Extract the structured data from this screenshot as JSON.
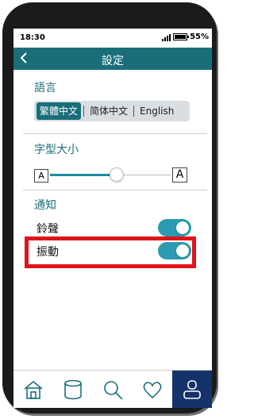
{
  "status_bar": {
    "time": "18:30",
    "battery": "55%"
  },
  "nav": {
    "back_icon": "chevron-left-icon",
    "title": "設定"
  },
  "language": {
    "title": "語言",
    "options": [
      "繁體中文",
      "简体中文",
      "English"
    ],
    "selected": "繁體中文"
  },
  "font_size": {
    "title": "字型大小",
    "small_label": "A",
    "large_label": "A",
    "level": 0.52
  },
  "notifications": {
    "title": "通知",
    "ringtone": {
      "label": "鈴聲",
      "on": true
    },
    "vibration": {
      "label": "振動",
      "on": true
    }
  },
  "tab_bar": {
    "items": [
      "home-icon",
      "database-icon",
      "search-icon",
      "heart-icon",
      "user-icon"
    ],
    "active": "user-icon"
  },
  "colors": {
    "primary": "#1a6e79",
    "toggle": "#2a9bb0",
    "highlight": "#e0141b",
    "tab_active": "#14336a"
  }
}
